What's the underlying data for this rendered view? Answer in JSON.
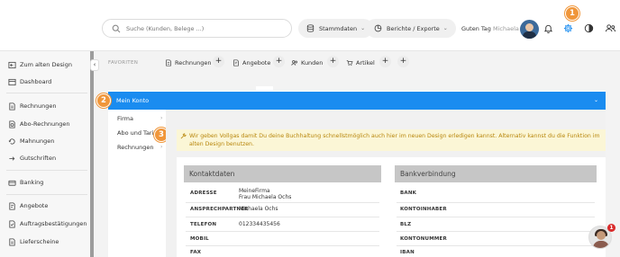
{
  "header": {
    "search_placeholder": "Suche (Kunden, Belege ...)",
    "stammdaten_label": "Stammdaten",
    "berichte_label": "Berichte / Exporte",
    "greeting": "Guten Tag",
    "user_name": "Michaela",
    "marker_1": "1"
  },
  "sidebar": {
    "items": [
      {
        "label": "Zum alten Design",
        "icon": "back-to-old-design-icon"
      },
      {
        "label": "Dashboard",
        "icon": "dashboard-icon"
      },
      {
        "label": "Rechnungen",
        "icon": "invoice-icon"
      },
      {
        "label": "Abo-Rechnungen",
        "icon": "subscription-invoice-icon"
      },
      {
        "label": "Mahnungen",
        "icon": "reminder-icon"
      },
      {
        "label": "Gutschriften",
        "icon": "credit-note-icon"
      },
      {
        "label": "Banking",
        "icon": "bank-icon"
      },
      {
        "label": "Angebote",
        "icon": "offer-icon"
      },
      {
        "label": "Auftragsbestätigungen",
        "icon": "order-confirmation-icon"
      },
      {
        "label": "Lieferscheine",
        "icon": "delivery-note-icon"
      }
    ]
  },
  "favorites": {
    "label": "FAVORITEN",
    "tabs": [
      {
        "label": "Rechnungen"
      },
      {
        "label": "Angebote"
      },
      {
        "label": "Kunden"
      },
      {
        "label": "Artikel"
      }
    ]
  },
  "account": {
    "title": "Mein Konto",
    "marker_2": "2",
    "marker_3": "3",
    "subnav": [
      "Firma",
      "Abo und Tarife",
      "Rechnungen"
    ],
    "notice": "Wir geben Vollgas damit Du deine Buchhaltung schnellstmöglich auch hier im neuen Design erledigen kannst. Alternativ kannst du die Funktion im alten Design benutzen.",
    "contact_header": "Kontaktdaten",
    "bank_header": "Bankverbindung",
    "contact_rows": [
      {
        "label": "ADRESSE",
        "value_line1": "MeineFirma",
        "value_line2": "Frau Michaela Ochs"
      },
      {
        "label": "ANSPRECHPARTNER",
        "value_line1": "Michaela Ochs"
      },
      {
        "label": "TELEFON",
        "value_line1": "012334435456"
      },
      {
        "label": "MOBIL",
        "value_line1": ""
      },
      {
        "label": "FAX",
        "value_line1": ""
      }
    ],
    "bank_rows": [
      {
        "label": "BANK"
      },
      {
        "label": "KONTOINHABER"
      },
      {
        "label": "BLZ"
      },
      {
        "label": "KONTONUMMER"
      },
      {
        "label": "IBAN"
      }
    ]
  },
  "chat": {
    "badge": "1"
  },
  "colors": {
    "accent": "#1a8cf0",
    "marker": "#f0963a",
    "notice_bg": "#fbf6d6",
    "notice_text": "#b8860b"
  }
}
